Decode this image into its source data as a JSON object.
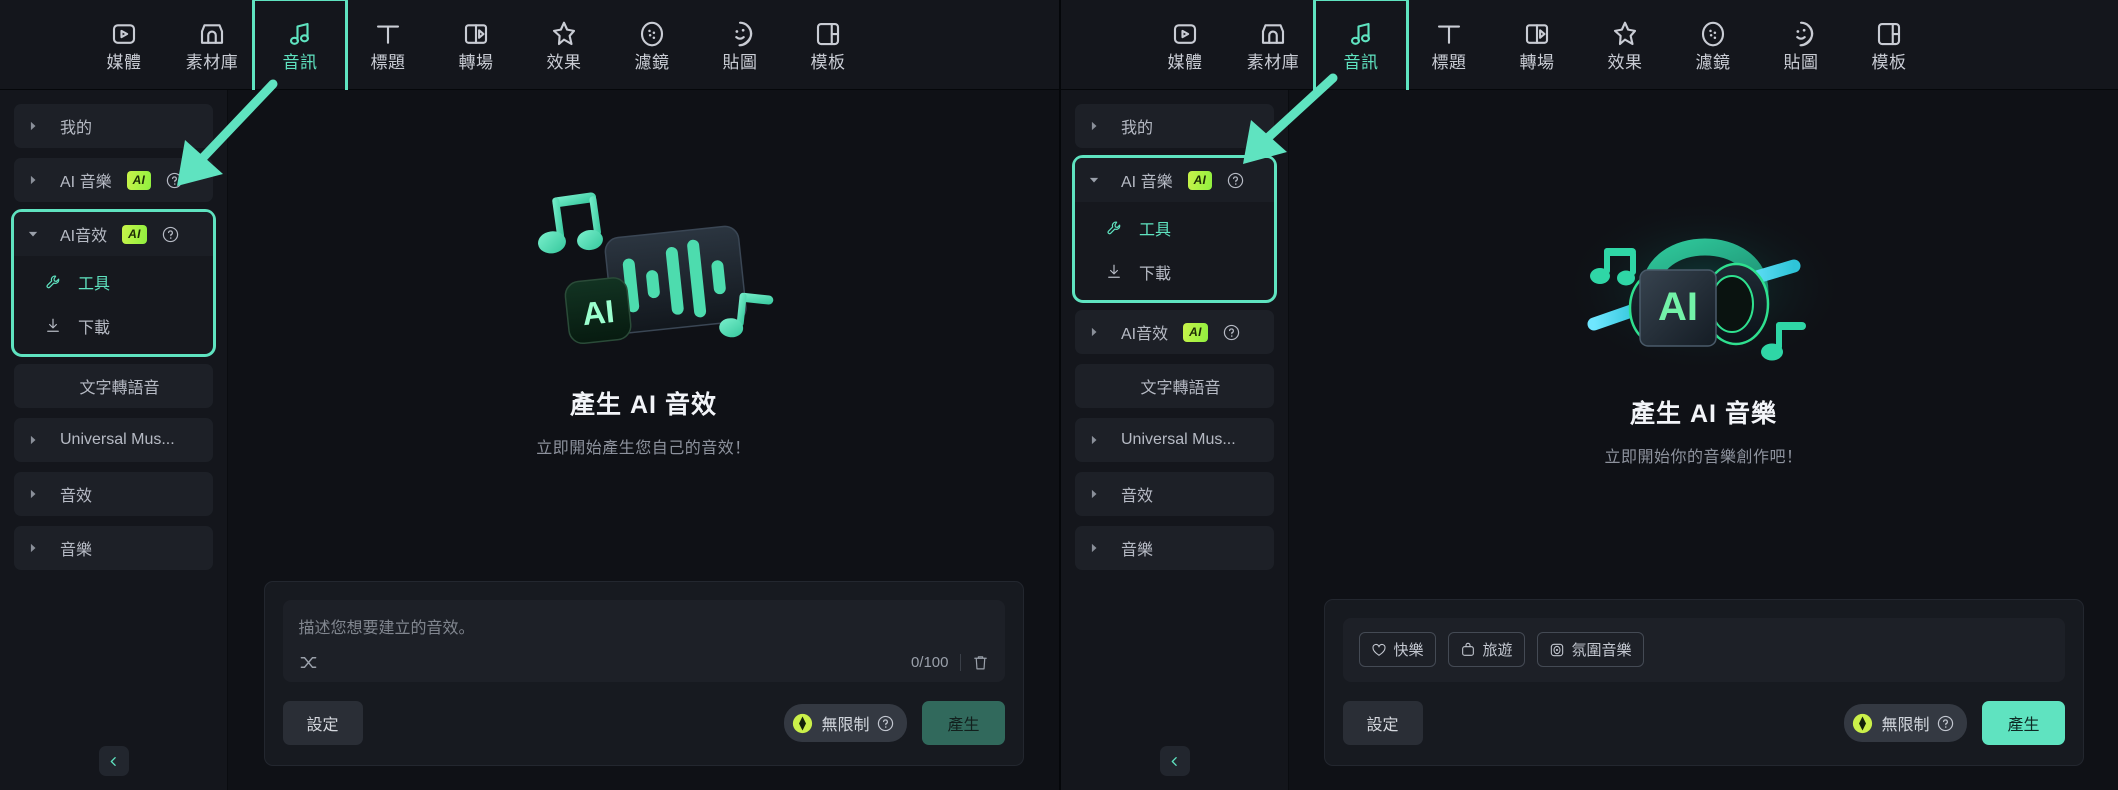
{
  "toolbar": {
    "items": [
      {
        "label": "媒體",
        "icon": "media-icon",
        "active": false
      },
      {
        "label": "素材庫",
        "icon": "stock-library-icon",
        "active": false
      },
      {
        "label": "音訊",
        "icon": "audio-note-icon",
        "active": true
      },
      {
        "label": "標題",
        "icon": "title-text-icon",
        "active": false
      },
      {
        "label": "轉場",
        "icon": "transition-icon",
        "active": false
      },
      {
        "label": "效果",
        "icon": "effect-icon",
        "active": false
      },
      {
        "label": "濾鏡",
        "icon": "filter-icon",
        "active": false
      },
      {
        "label": "貼圖",
        "icon": "sticker-icon",
        "active": false
      },
      {
        "label": "模板",
        "icon": "template-icon",
        "active": false
      }
    ]
  },
  "left_panel": {
    "sidebar": {
      "groups": [
        {
          "label": "我的",
          "badge": null,
          "help": false,
          "expanded": false,
          "highlight": false,
          "caret": true,
          "children": []
        },
        {
          "label": "AI 音樂",
          "badge": "AI",
          "help": true,
          "expanded": false,
          "highlight": false,
          "caret": true,
          "children": []
        },
        {
          "label": "AI音效",
          "badge": "AI",
          "help": true,
          "expanded": true,
          "highlight": true,
          "caret": true,
          "children": [
            {
              "label": "工具",
              "icon": "wrench-icon",
              "active": true
            },
            {
              "label": "下載",
              "icon": "download-icon",
              "active": false
            }
          ]
        },
        {
          "label": "文字轉語音",
          "badge": null,
          "help": false,
          "expanded": false,
          "highlight": false,
          "caret": false,
          "children": []
        },
        {
          "label": "Universal Mus...",
          "badge": null,
          "help": false,
          "expanded": false,
          "highlight": false,
          "caret": true,
          "children": []
        },
        {
          "label": "音效",
          "badge": null,
          "help": false,
          "expanded": false,
          "highlight": false,
          "caret": true,
          "children": []
        },
        {
          "label": "音樂",
          "badge": null,
          "help": false,
          "expanded": false,
          "highlight": false,
          "caret": true,
          "children": []
        }
      ],
      "collapse_icon": "chevron-left-icon"
    },
    "hero": {
      "art": "ai-sound-effect-illustration",
      "title": "產生 AI 音效",
      "subtitle": "立即開始產生您自己的音效！"
    },
    "prompt": {
      "placeholder": "描述您想要建立的音效。",
      "value": "",
      "counter": "0/100",
      "shuffle_icon": "shuffle-icon",
      "trash_icon": "trash-icon"
    },
    "actions": {
      "settings_label": "設定",
      "credit_label": "無限制",
      "credit_icon": "gem-icon",
      "credit_help_icon": "question-mark-icon",
      "generate_label": "產生",
      "generate_state": "muted"
    }
  },
  "right_panel": {
    "sidebar": {
      "groups": [
        {
          "label": "我的",
          "badge": null,
          "help": false,
          "expanded": false,
          "highlight": false,
          "caret": true,
          "children": []
        },
        {
          "label": "AI 音樂",
          "badge": "AI",
          "help": true,
          "expanded": true,
          "highlight": true,
          "caret": true,
          "children": [
            {
              "label": "工具",
              "icon": "wrench-icon",
              "active": true
            },
            {
              "label": "下載",
              "icon": "download-icon",
              "active": false
            }
          ]
        },
        {
          "label": "AI音效",
          "badge": "AI",
          "help": true,
          "expanded": false,
          "highlight": false,
          "caret": true,
          "children": []
        },
        {
          "label": "文字轉語音",
          "badge": null,
          "help": false,
          "expanded": false,
          "highlight": false,
          "caret": false,
          "children": []
        },
        {
          "label": "Universal Mus...",
          "badge": null,
          "help": false,
          "expanded": false,
          "highlight": false,
          "caret": true,
          "children": []
        },
        {
          "label": "音效",
          "badge": null,
          "help": false,
          "expanded": false,
          "highlight": false,
          "caret": true,
          "children": []
        },
        {
          "label": "音樂",
          "badge": null,
          "help": false,
          "expanded": false,
          "highlight": false,
          "caret": true,
          "children": []
        }
      ],
      "collapse_icon": "chevron-left-icon"
    },
    "hero": {
      "art": "ai-music-headphone-illustration",
      "title": "產生 AI 音樂",
      "subtitle": "立即開始你的音樂創作吧！"
    },
    "chips": [
      {
        "label": "快樂",
        "icon": "heart-icon"
      },
      {
        "label": "旅遊",
        "icon": "bag-icon"
      },
      {
        "label": "氛圍音樂",
        "icon": "ambient-icon"
      }
    ],
    "actions": {
      "settings_label": "設定",
      "credit_label": "無限制",
      "credit_icon": "gem-icon",
      "credit_help_icon": "question-mark-icon",
      "generate_label": "產生",
      "generate_state": "bright"
    }
  },
  "annotations": {
    "accent_color": "#5fe3c0",
    "arrow_left": "arrow-pointing-to-ai-sound-effect-group",
    "arrow_right": "arrow-pointing-to-ai-music-group"
  }
}
